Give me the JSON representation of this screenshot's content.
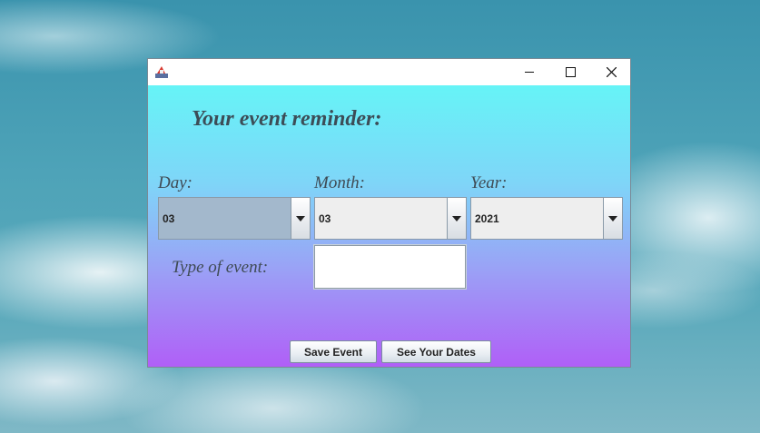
{
  "window": {
    "controls": {
      "minimize": "—",
      "maximize": "☐",
      "close": "✕"
    }
  },
  "form": {
    "heading": "Your event reminder:",
    "day_label": "Day:",
    "month_label": "Month:",
    "year_label": "Year:",
    "day_value": "03",
    "month_value": "03",
    "year_value": "2021",
    "type_label": "Type of event:",
    "type_value": ""
  },
  "buttons": {
    "save": "Save Event",
    "see_dates": "See Your Dates"
  },
  "colors": {
    "gradient_top": "#66f4f7",
    "gradient_bottom": "#b05ff7",
    "heading": "#3c4d57",
    "day_combo_selected": "#a3b8cc"
  }
}
